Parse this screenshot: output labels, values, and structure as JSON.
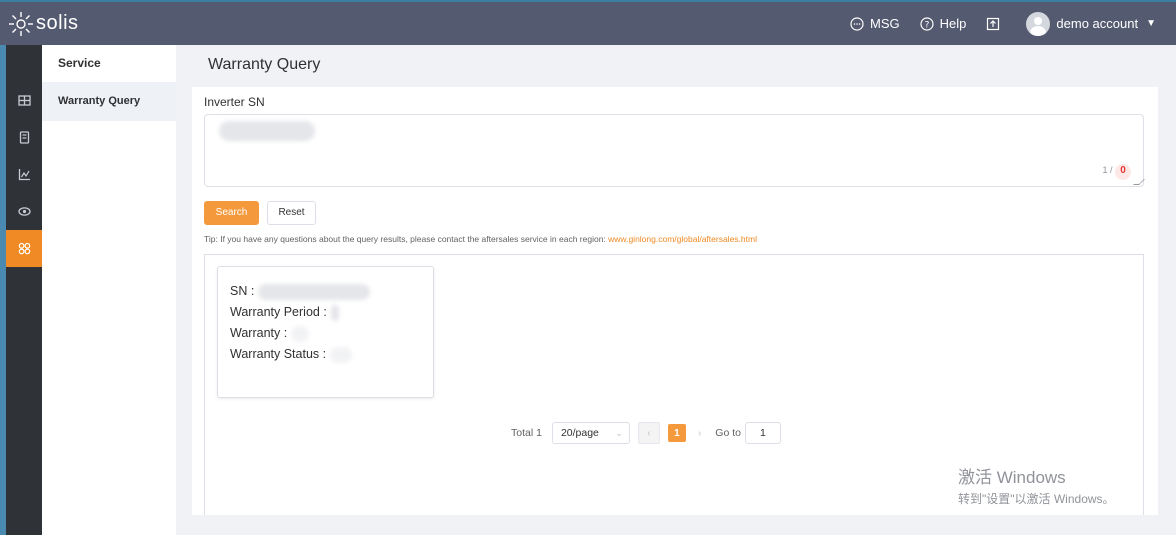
{
  "app": {
    "name": "solis"
  },
  "topbar": {
    "msg_label": "MSG",
    "help_label": "Help",
    "account_label": "demo account"
  },
  "rail": {
    "icons": [
      "dashboard-icon",
      "device-icon",
      "analytics-icon",
      "view-icon",
      "service-icon"
    ],
    "active_index": 4
  },
  "submenu": {
    "title": "Service",
    "items": [
      {
        "label": "Warranty Query"
      }
    ]
  },
  "page": {
    "title": "Warranty Query"
  },
  "form": {
    "sn_label": "Inverter SN",
    "counter_prefix": "1 /",
    "counter_badge": "0",
    "search_label": "Search",
    "reset_label": "Reset",
    "tip_text": "Tip: If you have any questions about the query results, please contact the aftersales service in each region: ",
    "tip_link": "www.ginlong.com/global/aftersales.html"
  },
  "result": {
    "sn_label": "SN :",
    "period_label": "Warranty Period :",
    "warranty_label": "Warranty :",
    "status_label": "Warranty Status :"
  },
  "pagination": {
    "total": "Total 1",
    "page_size": "20/page",
    "current_page": "1",
    "goto_label": "Go to",
    "goto_value": "1"
  },
  "watermark": {
    "line1": "激活 Windows",
    "line2": "转到\"设置\"以激活 Windows。"
  },
  "colors": {
    "accent": "#f59a3c",
    "topbar": "#545a6f",
    "rail": "#2f3237"
  }
}
